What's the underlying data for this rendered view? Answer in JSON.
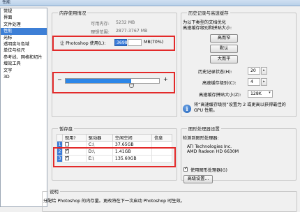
{
  "window": {
    "title": "性能"
  },
  "sidebar": {
    "items": [
      {
        "label": "常规",
        "selected": false
      },
      {
        "label": "界面",
        "selected": false
      },
      {
        "label": "文件处理",
        "selected": false
      },
      {
        "label": "性能",
        "selected": true
      },
      {
        "label": "光标",
        "selected": false
      },
      {
        "label": "透明度与色域",
        "selected": false
      },
      {
        "label": "单位与标尺",
        "selected": false
      },
      {
        "label": "参考线、网格和切片",
        "selected": false
      },
      {
        "label": "增效工具",
        "selected": false
      },
      {
        "label": "文字",
        "selected": false
      },
      {
        "label": "3D",
        "selected": false
      }
    ]
  },
  "memory": {
    "title": "内存使用情况",
    "available_label": "可用内存:",
    "available_value": "5232 MB",
    "ideal_label": "理想范围:",
    "ideal_value": "2877-3767 MB",
    "use_label": "让 Photoshop 使用(L):",
    "use_value": "3698",
    "use_suffix": "MB(70%)",
    "minus": "−",
    "plus": "+",
    "slider_fraction": 0.7
  },
  "history": {
    "title": "历史记录与高速缓存",
    "desc_line1": "为以下类型的文档优化",
    "desc_line2": "高速缓存级别和拼贴大小:",
    "btn_tall_thin": "高而窄",
    "btn_default": "默认",
    "btn_big_flat": "大而平",
    "states_label": "历史记录状态(H):",
    "states_value": "20",
    "cache_levels_label": "高速缓存级别(C):",
    "cache_levels_value": "4",
    "tile_size_label": "高速缓存拼贴大小(Z):",
    "tile_size_value": "128K",
    "info_line1": "将“高速缓存级别”设置为 2 或更高以获得最佳的",
    "info_line2": "GPU 性能。",
    "info_icon": "info-icon"
  },
  "scratch": {
    "title": "暂存盘",
    "columns": [
      "现用?",
      "驱动器",
      "空闲空间",
      "信息"
    ],
    "rows": [
      {
        "idx": "1",
        "checked": false,
        "drive": "C:\\",
        "free": "37.65GB",
        "info": ""
      },
      {
        "idx": "2",
        "checked": true,
        "drive": "D:\\",
        "free": "1.41GB",
        "info": ""
      },
      {
        "idx": "3",
        "checked": true,
        "drive": "E:\\",
        "free": "135.60GB",
        "info": ""
      }
    ]
  },
  "gpu": {
    "title": "图形处理器设置",
    "detected_label": "检测到图形处理器:",
    "card_line1": "ATI Technologies Inc.",
    "card_line2": "AMD Radeon HD 6630M",
    "use_gpu_label": "使用图形处理器(G)",
    "use_gpu_checked": true,
    "advanced_btn": "高级设置..."
  },
  "description": {
    "title": "说明",
    "text": "分配给 Photoshop 的内存量。更改将在下一次启动 Photoshop 时生效。"
  },
  "colors": {
    "accent": "#3a7bd8",
    "highlight": "#e32a2a",
    "slider": "#2b86e8"
  }
}
